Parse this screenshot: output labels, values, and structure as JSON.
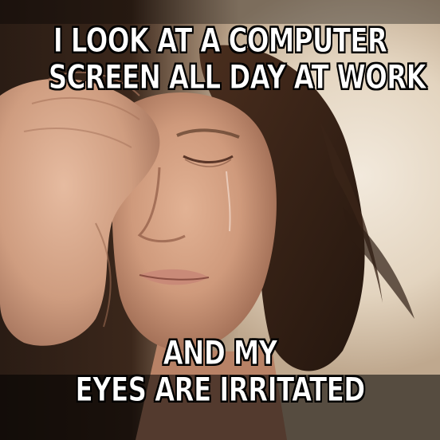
{
  "meme": {
    "top_text": [
      "I LOOK AT A COMPUTER",
      "SCREEN ALL DAY AT WORK"
    ],
    "bottom_text": [
      "AND MY",
      "EYES ARE IRRITATED"
    ],
    "text_color": "#ffffff",
    "outline_color": "#000000"
  },
  "photo": {
    "subject": "woman-crying-with-hand-on-forehead",
    "palette": {
      "background_dark": "#1a1410",
      "background_light": "#e8dccb",
      "skin": "#d9a88a",
      "skin_shadow": "#b07d64",
      "hair": "#3a2418",
      "lips": "#c98a78"
    }
  }
}
